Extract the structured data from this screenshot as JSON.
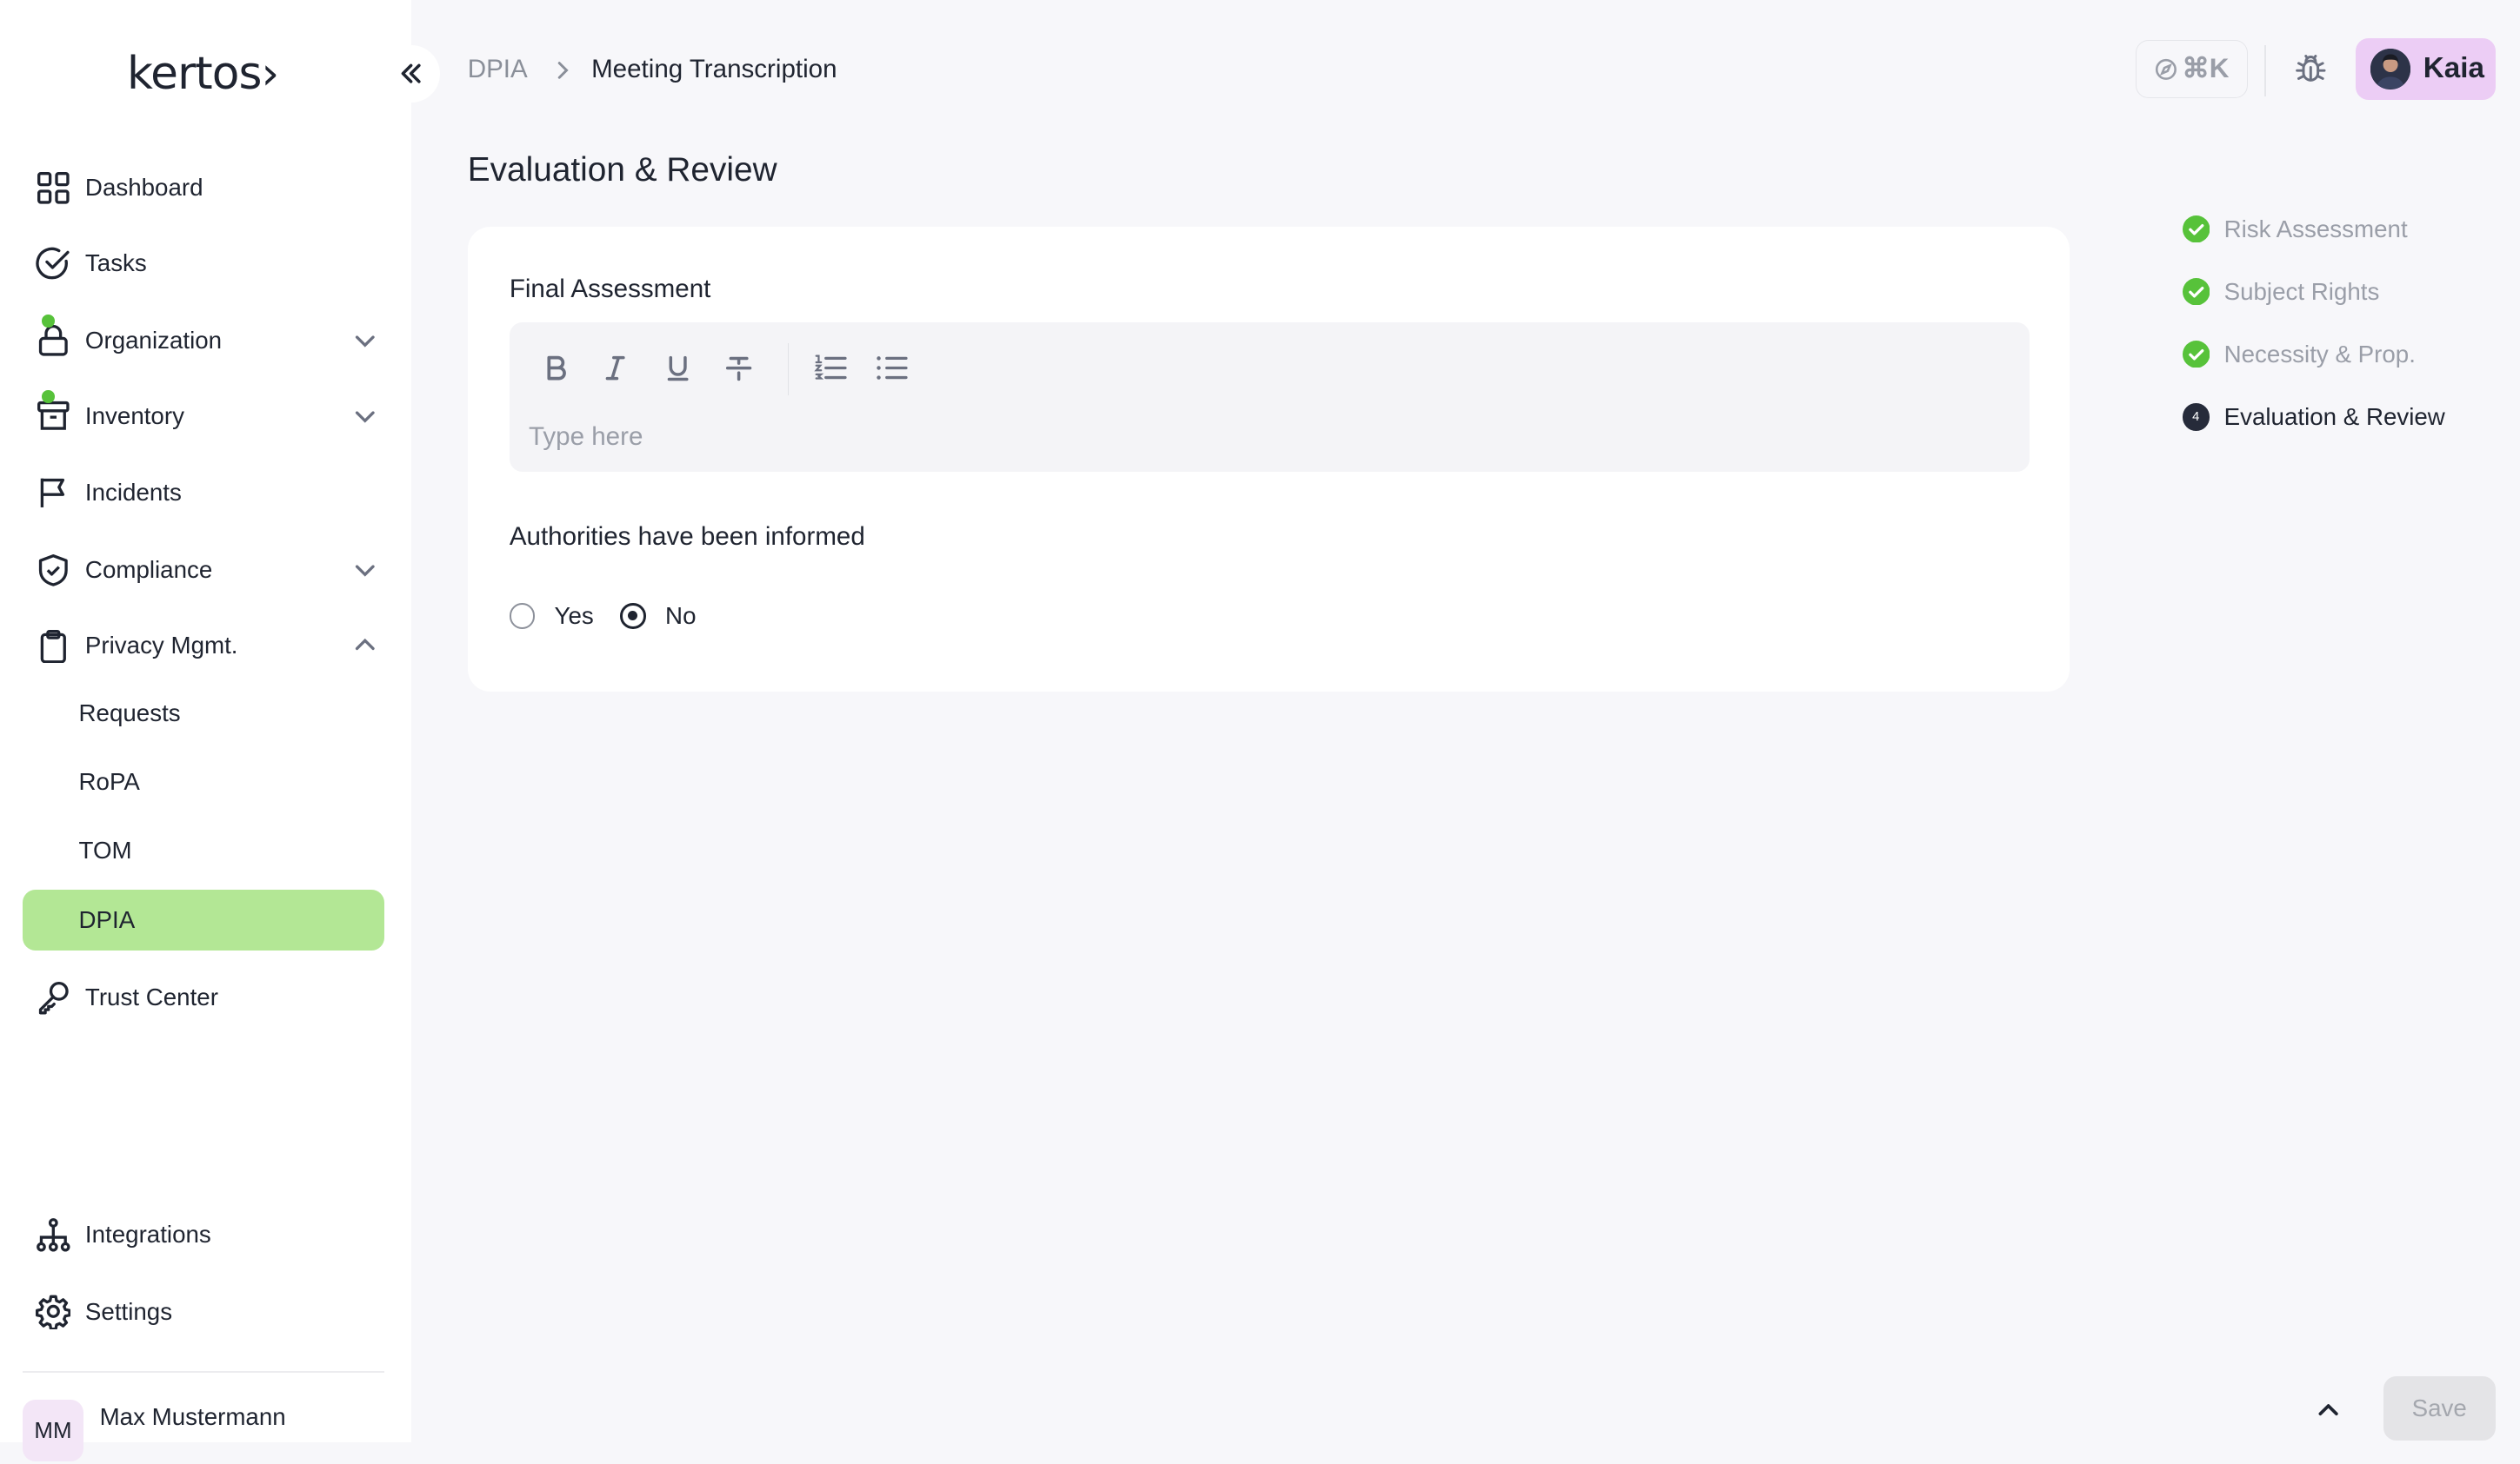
{
  "app": {
    "logo": "kertos›"
  },
  "sidebar": {
    "items": [
      {
        "label": "Dashboard",
        "icon": "grid-icon"
      },
      {
        "label": "Tasks",
        "icon": "check-circle-icon"
      },
      {
        "label": "Organization",
        "icon": "lock-icon",
        "has_dot": true,
        "chevron": "down"
      },
      {
        "label": "Inventory",
        "icon": "archive-icon",
        "has_dot": true,
        "chevron": "down"
      },
      {
        "label": "Incidents",
        "icon": "flag-icon"
      },
      {
        "label": "Compliance",
        "icon": "shield-check-icon",
        "chevron": "down"
      },
      {
        "label": "Privacy Mgmt.",
        "icon": "clipboard-icon",
        "chevron": "up"
      },
      {
        "label": "Trust Center",
        "icon": "key-icon"
      }
    ],
    "sub_items": [
      {
        "label": "Requests"
      },
      {
        "label": "RoPA"
      },
      {
        "label": "TOM"
      },
      {
        "label": "DPIA",
        "active": true
      }
    ],
    "bottom_items": [
      {
        "label": "Integrations",
        "icon": "network-icon"
      },
      {
        "label": "Settings",
        "icon": "gear-icon"
      }
    ],
    "user": {
      "initials": "MM",
      "name": "Max Mustermann"
    }
  },
  "header": {
    "breadcrumb": [
      "DPIA",
      "Meeting Transcription"
    ],
    "command_shortcut": "⌘K",
    "user_name": "Kaia"
  },
  "main": {
    "page_title": "Evaluation & Review",
    "final_assessment": {
      "label": "Final Assessment",
      "placeholder": "Type here",
      "value": "",
      "toolbar": [
        "bold-icon",
        "italic-icon",
        "underline-icon",
        "strikethrough-icon",
        "ordered-list-icon",
        "bullet-list-icon"
      ]
    },
    "authorities": {
      "label": "Authorities have been informed",
      "options": [
        "Yes",
        "No"
      ],
      "selected": "No"
    }
  },
  "steps": [
    {
      "label": "Risk Assessment",
      "status": "done"
    },
    {
      "label": "Subject Rights",
      "status": "done"
    },
    {
      "label": "Necessity & Prop.",
      "status": "done"
    },
    {
      "label": "Evaluation & Review",
      "status": "current",
      "number": "4"
    }
  ],
  "footer": {
    "save_label": "Save"
  },
  "colors": {
    "accent_green": "#b3e795",
    "check_green": "#57c23a",
    "user_chip": "#eccdf5"
  }
}
